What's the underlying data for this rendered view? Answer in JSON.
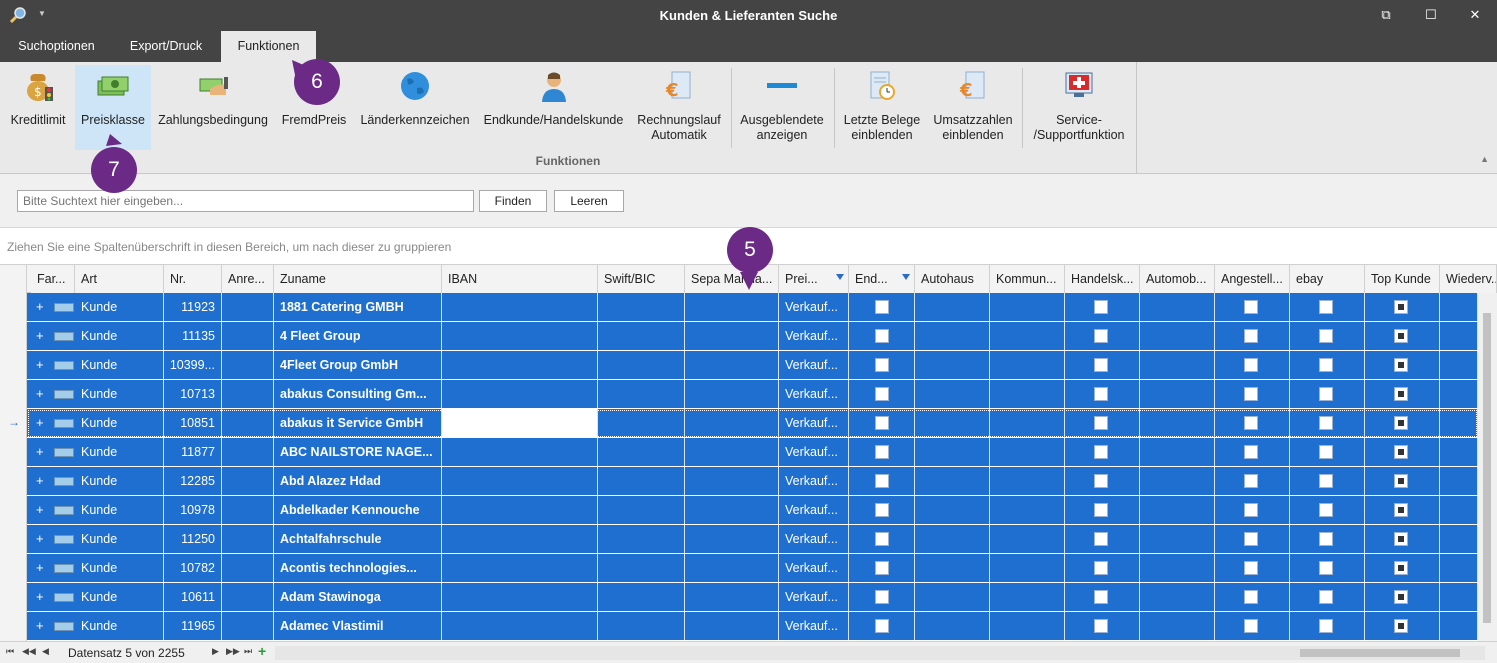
{
  "window": {
    "title": "Kunden & Lieferanten Suche"
  },
  "tabs": [
    {
      "label": "Suchoptionen"
    },
    {
      "label": "Export/Druck"
    },
    {
      "label": "Funktionen"
    }
  ],
  "ribbon": {
    "group_label": "Funktionen",
    "buttons": [
      {
        "label": "Kreditlimit",
        "icon": "money-bag-icon"
      },
      {
        "label": "Preisklasse",
        "icon": "banknotes-icon"
      },
      {
        "label": "Zahlungsbedingung",
        "icon": "payment-hand-icon"
      },
      {
        "label": "FremdPreis",
        "icon": "coins-icon"
      },
      {
        "label": "Länderkennzeichen",
        "icon": "globe-icon"
      },
      {
        "label": "Endkunde/Handelskunde",
        "icon": "user-icon"
      },
      {
        "label": "Rechnungslauf Automatik",
        "icon": "euro-document-icon"
      },
      {
        "label": "Ausgeblendete anzeigen",
        "icon": "minus-bar-icon"
      },
      {
        "label": "Letzte Belege einblenden",
        "icon": "document-clock-icon"
      },
      {
        "label": "Umsatzzahlen einblenden",
        "icon": "euro-document-icon"
      },
      {
        "label": "Service- /Supportfunktion",
        "icon": "support-cross-icon"
      }
    ]
  },
  "search": {
    "placeholder": "Bitte Suchtext hier eingeben...",
    "find_label": "Finden",
    "clear_label": "Leeren"
  },
  "group_panel": {
    "hint": "Ziehen Sie eine Spaltenüberschrift in diesen Bereich, um nach dieser zu gruppieren"
  },
  "grid": {
    "columns": [
      {
        "label": "Far..."
      },
      {
        "label": "Art"
      },
      {
        "label": "Nr."
      },
      {
        "label": "Anre..."
      },
      {
        "label": "Zuname"
      },
      {
        "label": "IBAN"
      },
      {
        "label": "Swift/BIC"
      },
      {
        "label": "Sepa Manda..."
      },
      {
        "label": "Prei..."
      },
      {
        "label": "End..."
      },
      {
        "label": "Autohaus"
      },
      {
        "label": "Kommun..."
      },
      {
        "label": "Handelsk..."
      },
      {
        "label": "Automob..."
      },
      {
        "label": "Angestell..."
      },
      {
        "label": "ebay"
      },
      {
        "label": "Top Kunde"
      },
      {
        "label": "Wiederv..."
      }
    ],
    "rows": [
      {
        "art": "Kunde",
        "nr": "11923",
        "zuname": "1881 Catering GMBH",
        "preis": "Verkauf..."
      },
      {
        "art": "Kunde",
        "nr": "11135",
        "zuname": "4 Fleet Group",
        "preis": "Verkauf..."
      },
      {
        "art": "Kunde",
        "nr": "10399...",
        "zuname": "4Fleet Group GmbH",
        "preis": "Verkauf..."
      },
      {
        "art": "Kunde",
        "nr": "10713",
        "zuname": "abakus Consulting Gm...",
        "preis": "Verkauf..."
      },
      {
        "art": "Kunde",
        "nr": "10851",
        "zuname": "abakus it Service GmbH",
        "preis": "Verkauf..."
      },
      {
        "art": "Kunde",
        "nr": "11877",
        "zuname": "ABC NAILSTORE NAGE...",
        "preis": "Verkauf..."
      },
      {
        "art": "Kunde",
        "nr": "12285",
        "zuname": "Abd Alazez Hdad",
        "preis": "Verkauf..."
      },
      {
        "art": "Kunde",
        "nr": "10978",
        "zuname": "Abdelkader Kennouche",
        "preis": "Verkauf..."
      },
      {
        "art": "Kunde",
        "nr": "11250",
        "zuname": "Achtalfahrschule",
        "preis": "Verkauf..."
      },
      {
        "art": "Kunde",
        "nr": "10782",
        "zuname": "Acontis technologies...",
        "preis": "Verkauf..."
      },
      {
        "art": "Kunde",
        "nr": "10611",
        "zuname": "Adam Stawinoga",
        "preis": "Verkauf..."
      },
      {
        "art": "Kunde",
        "nr": "11965",
        "zuname": "Adamec Vlastimil",
        "preis": "Verkauf..."
      }
    ]
  },
  "navigator": {
    "record_text": "Datensatz 5 von 2255"
  },
  "annotations": [
    {
      "label": "6"
    },
    {
      "label": "7"
    },
    {
      "label": "5"
    }
  ],
  "colors": {
    "selection": "#1f6fd1",
    "annotation": "#6a2a85",
    "titlebar": "#444444"
  }
}
